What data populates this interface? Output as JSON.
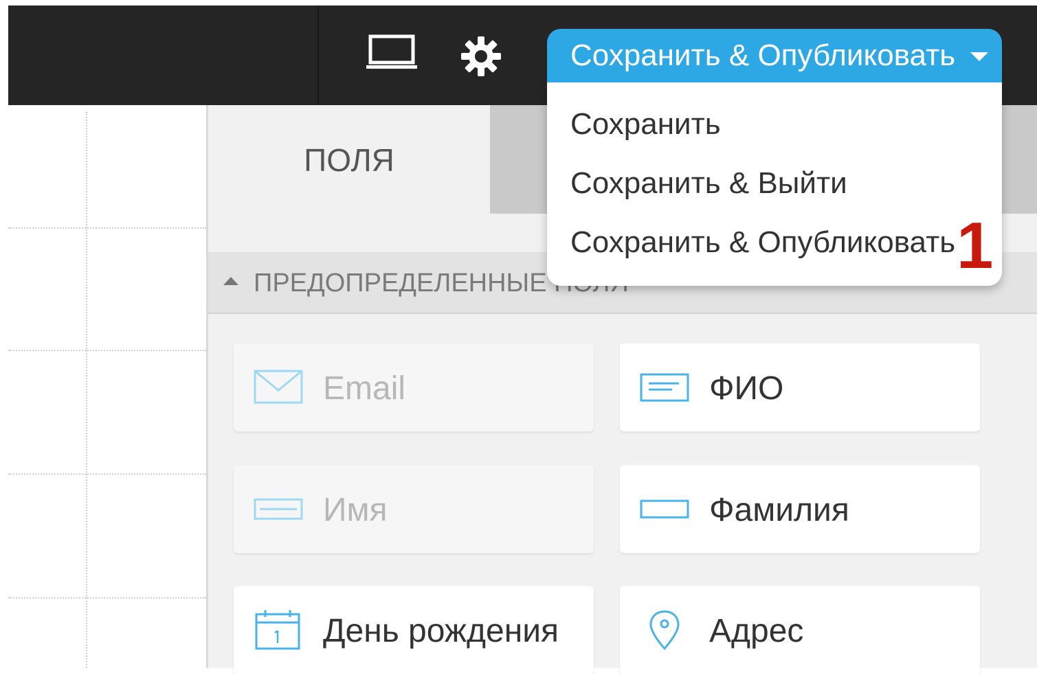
{
  "toolbar": {
    "preview_icon": "laptop-icon",
    "settings_icon": "gear-icon",
    "publish_button_label": "Сохранить & Опубликовать"
  },
  "publish_menu": {
    "items": [
      {
        "label": "Сохранить"
      },
      {
        "label": "Сохранить & Выйти"
      },
      {
        "label": "Сохранить & Опубликовать"
      }
    ],
    "annotation_marker": "1"
  },
  "panel": {
    "tabs": [
      {
        "label": "ПОЛЯ",
        "active": true
      },
      {
        "label": "",
        "active": false
      }
    ],
    "section": {
      "title": "ПРЕДОПРЕДЕЛЕННЫЕ ПОЛЯ",
      "expanded": true
    },
    "fields": [
      {
        "label": "Email",
        "icon": "envelope-icon",
        "state": "disabled"
      },
      {
        "label": "ФИО",
        "icon": "text-lines-icon",
        "state": "enabled"
      },
      {
        "label": "Имя",
        "icon": "text-field-icon",
        "state": "disabled"
      },
      {
        "label": "Фамилия",
        "icon": "text-field-icon",
        "state": "enabled"
      },
      {
        "label": "День рождения",
        "icon": "calendar-icon",
        "state": "enabled"
      },
      {
        "label": "Адрес",
        "icon": "map-pin-icon",
        "state": "enabled"
      }
    ]
  },
  "colors": {
    "topbar": "#252525",
    "accent": "#2ea8e5",
    "annotation": "#c71a0d",
    "icon_blue": "#49b3e8"
  }
}
